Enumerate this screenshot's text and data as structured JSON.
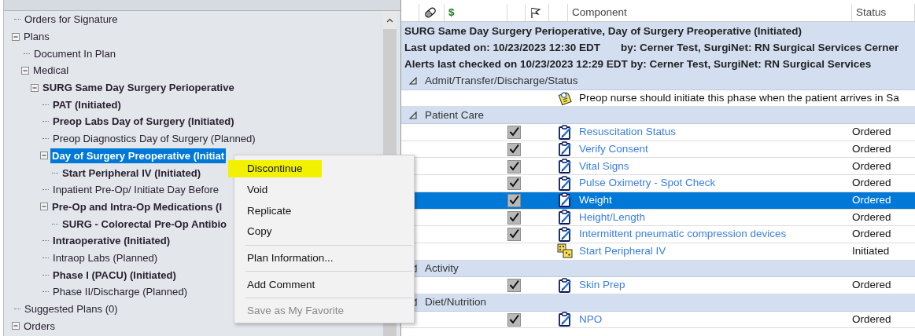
{
  "tree_pane": {
    "items": [
      {
        "label": "Orders for Signature",
        "bold": false,
        "selected": false
      },
      {
        "label": "Plans",
        "bold": false,
        "selected": false,
        "expanded": true,
        "children": [
          {
            "label": "Document In Plan",
            "bold": false,
            "selected": false
          },
          {
            "label": "Medical",
            "bold": false,
            "selected": false,
            "expanded": true,
            "children": [
              {
                "label": "SURG Same Day Surgery Perioperative",
                "bold": true,
                "selected": false,
                "expanded": true,
                "children": [
                  {
                    "label": "PAT (Initiated)",
                    "bold": true,
                    "selected": false
                  },
                  {
                    "label": "Preop Labs Day of Surgery (Initiated)",
                    "bold": true,
                    "selected": false
                  },
                  {
                    "label": "Preop Diagnostics Day of Surgery (Planned)",
                    "bold": false,
                    "selected": false
                  },
                  {
                    "label": "Day of Surgery Preoperative (Initiat",
                    "bold": true,
                    "selected": true,
                    "expanded": true,
                    "children": [
                      {
                        "label": "Start Peripheral IV (Initiated)",
                        "bold": true,
                        "selected": false
                      }
                    ]
                  },
                  {
                    "label": "Inpatient Pre-Op/ Initiate Day Before",
                    "bold": false,
                    "selected": false
                  },
                  {
                    "label": "Pre-Op and Intra-Op Medications (I",
                    "bold": true,
                    "selected": false,
                    "expanded": true,
                    "children": [
                      {
                        "label": "SURG - Colorectal Pre-Op Antibio",
                        "bold": true,
                        "selected": false
                      }
                    ]
                  },
                  {
                    "label": "Intraoperative (Initiated)",
                    "bold": true,
                    "selected": false
                  },
                  {
                    "label": "Intraop Labs (Planned)",
                    "bold": false,
                    "selected": false
                  },
                  {
                    "label": "Phase I (PACU) (Initiated)",
                    "bold": true,
                    "selected": false
                  },
                  {
                    "label": "Phase II/Discharge (Planned)",
                    "bold": false,
                    "selected": false
                  }
                ]
              }
            ]
          }
        ]
      },
      {
        "label": "Suggested Plans (0)",
        "bold": false,
        "selected": false
      },
      {
        "label": "Orders",
        "bold": false,
        "selected": false,
        "expanded": true
      }
    ]
  },
  "orders_pane": {
    "columns": [
      {
        "kind": "empty"
      },
      {
        "kind": "pill"
      },
      {
        "kind": "text",
        "label": "$"
      },
      {
        "kind": "empty"
      },
      {
        "kind": "flag"
      },
      {
        "kind": "empty"
      },
      {
        "kind": "text",
        "label": "Component"
      },
      {
        "kind": "text",
        "label": "Status"
      }
    ],
    "info": {
      "title": "SURG Same Day Surgery Perioperative, Day of Surgery Preoperative (Initiated)",
      "last_updated": "Last updated on: 10/23/2023 12:30 EDT",
      "updated_by": "by: Cerner Test, SurgiNet: RN Surgical Services Cerner",
      "alerts": "Alerts last checked on 10/23/2023 12:29 EDT by: Cerner Test, SurgiNet: RN Surgical Services"
    },
    "sections": [
      {
        "title": "Admit/Transfer/Discharge/Status",
        "expanded": true,
        "rows": [
          {
            "kind": "note",
            "checked": false,
            "selected": false,
            "component": "Preop nurse should initiate this phase when the patient arrives in Sa"
          }
        ]
      },
      {
        "title": "Patient Care",
        "expanded": true,
        "rows": [
          {
            "kind": "order",
            "checked": true,
            "selected": false,
            "component": "Resuscitation Status",
            "status": "Ordered"
          },
          {
            "kind": "order",
            "checked": true,
            "selected": false,
            "component": "Verify Consent",
            "status": "Ordered"
          },
          {
            "kind": "order",
            "checked": true,
            "selected": false,
            "component": "Vital Signs",
            "status": "Ordered"
          },
          {
            "kind": "order",
            "checked": true,
            "selected": false,
            "component": "Pulse Oximetry - Spot Check",
            "status": "Ordered"
          },
          {
            "kind": "order",
            "checked": true,
            "selected": true,
            "component": "Weight",
            "status": "Ordered"
          },
          {
            "kind": "order",
            "checked": true,
            "selected": false,
            "component": "Height/Length",
            "status": "Ordered"
          },
          {
            "kind": "order",
            "checked": true,
            "selected": false,
            "component": "Intermittent pneumatic compression devices",
            "status": "Ordered"
          },
          {
            "kind": "subphase",
            "checked": false,
            "selected": false,
            "component": "Start Peripheral IV",
            "status": "Initiated"
          }
        ]
      },
      {
        "title": "Activity",
        "expanded": true,
        "rows": [
          {
            "kind": "order",
            "checked": true,
            "selected": false,
            "component": "Skin Prep",
            "status": "Ordered"
          }
        ]
      },
      {
        "title": "Diet/Nutrition",
        "expanded": true,
        "rows": [
          {
            "kind": "order",
            "checked": true,
            "selected": false,
            "component": "NPO",
            "status": "Ordered"
          }
        ]
      }
    ]
  },
  "context_menu": {
    "items": [
      {
        "kind": "item",
        "label": "Discontinue",
        "highlighted": true,
        "disabled": false
      },
      {
        "kind": "item",
        "label": "Void",
        "highlighted": false,
        "disabled": false
      },
      {
        "kind": "item",
        "label": "Replicate",
        "highlighted": false,
        "disabled": false
      },
      {
        "kind": "item",
        "label": "Copy",
        "highlighted": false,
        "disabled": false
      },
      {
        "kind": "separator"
      },
      {
        "kind": "item",
        "label": "Plan Information...",
        "highlighted": false,
        "disabled": false
      },
      {
        "kind": "separator"
      },
      {
        "kind": "item",
        "label": "Add Comment",
        "highlighted": false,
        "disabled": false
      },
      {
        "kind": "separator"
      },
      {
        "kind": "item",
        "label": "Save as My Favorite",
        "highlighted": false,
        "disabled": true
      }
    ]
  }
}
